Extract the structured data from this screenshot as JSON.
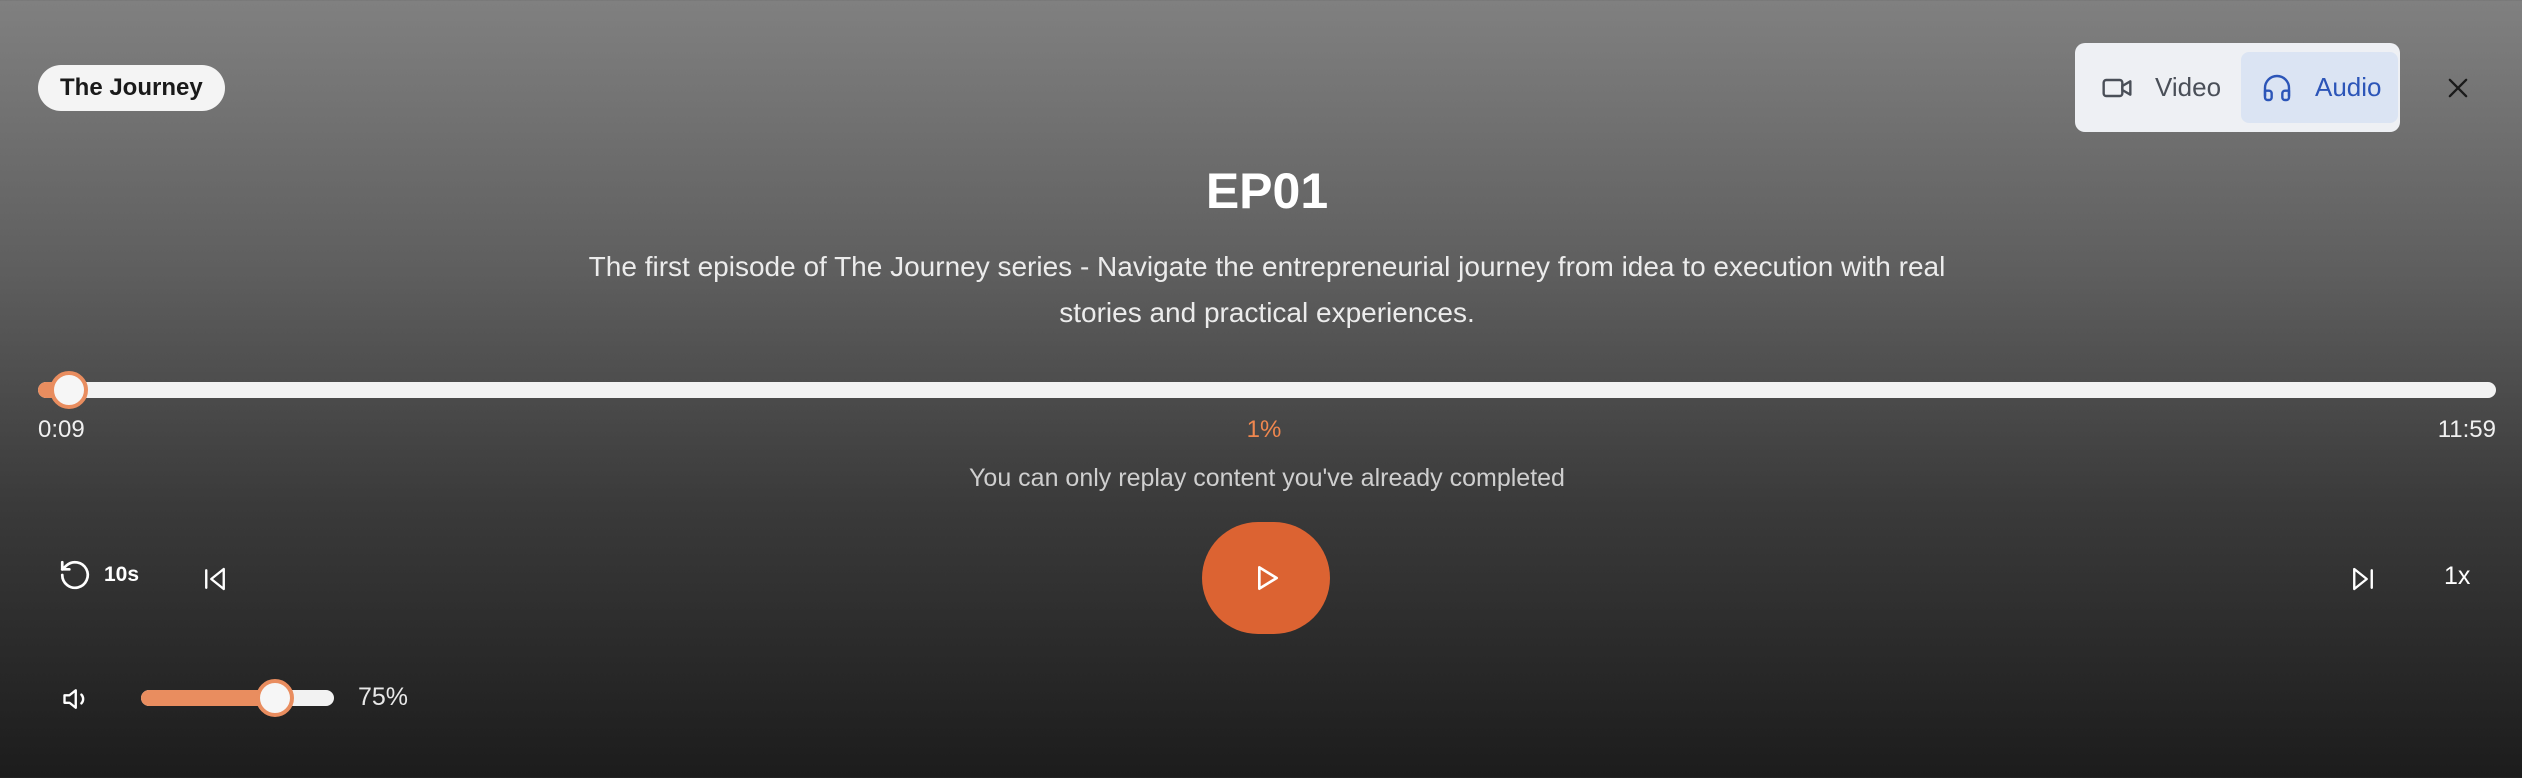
{
  "header": {
    "series_label": "The Journey",
    "mode_toggle": {
      "video_label": "Video",
      "audio_label": "Audio",
      "selected": "Audio",
      "video_icon": "video-camera-icon",
      "audio_icon": "headphones-icon"
    },
    "close_icon": "close-icon"
  },
  "episode": {
    "title": "EP01",
    "description": "The first episode of The Journey series - Navigate the entrepreneurial journey from idea to execution with real stories and practical experiences."
  },
  "progress": {
    "current_time": "0:09",
    "percent_label": "1%",
    "total_time": "11:59",
    "fraction": 0.0125,
    "note": "You can only replay content you've already completed"
  },
  "controls": {
    "rewind_label": "10s",
    "rewind_icon": "rotate-ccw-icon",
    "prev_icon": "skip-back-icon",
    "play_icon": "play-icon",
    "next_icon": "skip-forward-icon",
    "speed_label": "1x"
  },
  "volume": {
    "icon": "volume-icon",
    "level_percent": 75,
    "label": "75%"
  },
  "colors": {
    "accent": "#e98d5f",
    "play_button": "#dc6332",
    "percent_text": "#f0874f",
    "audio_selected_bg": "#dbe4f3",
    "audio_selected_text": "#2c55b8"
  }
}
